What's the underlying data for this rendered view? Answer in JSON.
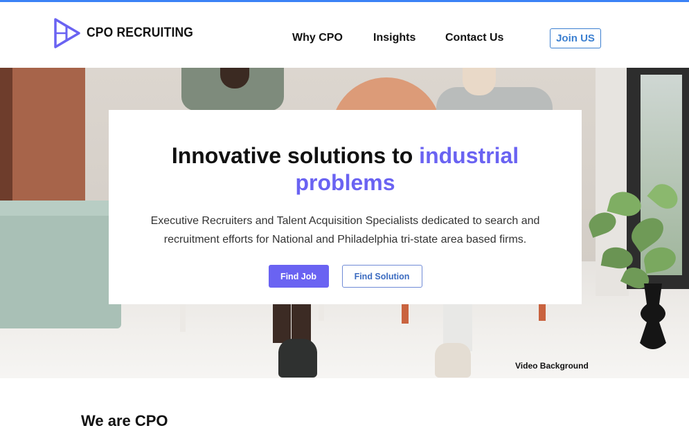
{
  "brand": {
    "name": "CPO RECRUITING",
    "logo_icon": "play-cube-logo",
    "accent_color": "#6a63f2"
  },
  "nav": {
    "items": [
      {
        "label": "Why CPO"
      },
      {
        "label": "Insights"
      },
      {
        "label": "Contact Us"
      }
    ],
    "join_label": "Join US"
  },
  "hero": {
    "title_part1": "Innovative solutions to ",
    "title_accent": "industrial problems",
    "description": "Executive Recruiters and Talent Acquisition Specialists dedicated to search and recruitment efforts for National and Philadelphia tri-state area based firms.",
    "primary_button": "Find Job",
    "secondary_button": "Find Solution",
    "background_label": "Video Background"
  },
  "about": {
    "title": "We are CPO"
  },
  "colors": {
    "primary": "#6a63f2",
    "outline_blue": "#3b7fd0",
    "selection": "#3b82f6"
  }
}
